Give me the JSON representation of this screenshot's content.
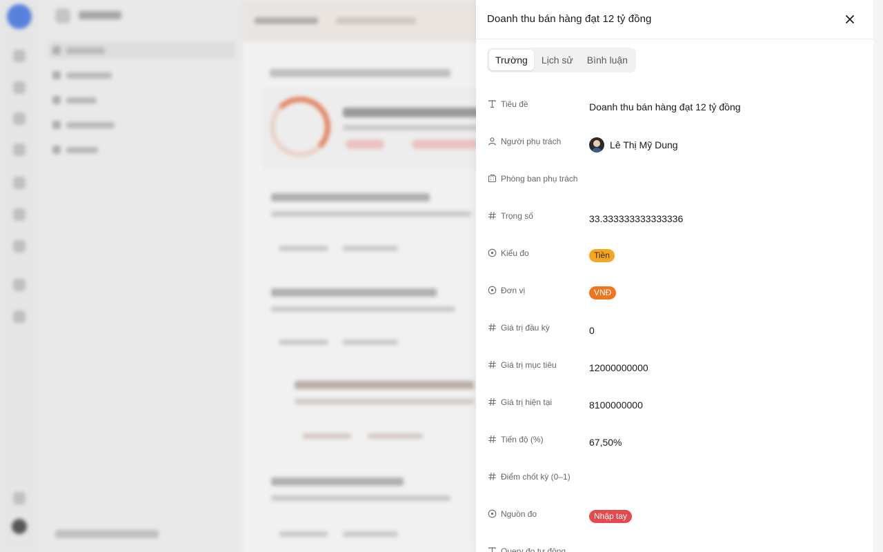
{
  "panel": {
    "title": "Doanh thu bán hàng đạt 12 tỷ đồng",
    "tabs": [
      {
        "label": "Trường",
        "active": true
      },
      {
        "label": "Lịch sử",
        "active": false
      },
      {
        "label": "Bình luận",
        "active": false
      }
    ],
    "fields": [
      {
        "icon": "text-type-icon",
        "label": "Tiêu đề",
        "value": "Doanh thu bán hàng đạt 12 tỷ đồng"
      },
      {
        "icon": "user-icon",
        "label": "Người phụ trách",
        "value": "Lê Thị Mỹ Dung"
      },
      {
        "icon": "building-icon",
        "label": "Phòng ban phụ trách",
        "value": ""
      },
      {
        "icon": "hash-icon",
        "label": "Trọng số",
        "value": "33.333333333333336"
      },
      {
        "icon": "select-circle-icon",
        "label": "Kiểu đo",
        "value": "Tiền",
        "badge_color": "#f5a623"
      },
      {
        "icon": "select-circle-icon",
        "label": "Đơn vị",
        "value": "VNĐ",
        "badge_color": "#f0751f"
      },
      {
        "icon": "hash-icon",
        "label": "Giá trị đầu kỳ",
        "value": "0"
      },
      {
        "icon": "hash-icon",
        "label": "Giá trị mục tiêu",
        "value": "12000000000"
      },
      {
        "icon": "hash-icon",
        "label": "Giá trị hiện tại",
        "value": "8100000000"
      },
      {
        "icon": "hash-icon",
        "label": "Tiến độ (%)",
        "value": "67,50%"
      },
      {
        "icon": "hash-icon",
        "label": "Điểm chốt kỳ (0–1)",
        "value": ""
      },
      {
        "icon": "select-circle-icon",
        "label": "Nguồn đo",
        "value": "Nhập tay",
        "badge_color": "#e5484d"
      },
      {
        "icon": "text-type-icon",
        "label": "Query đo tự động",
        "value": ""
      }
    ]
  },
  "colors": {
    "accent_orange": "#e8774d",
    "badge_tien": "#f5a623",
    "badge_vnd": "#f0751f",
    "badge_nhap_tay": "#e5484d"
  }
}
